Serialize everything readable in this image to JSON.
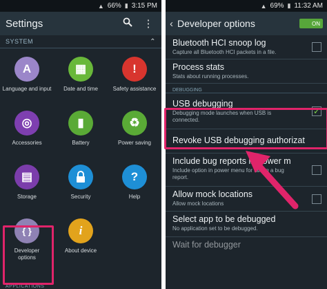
{
  "left": {
    "status": {
      "battery": "66%",
      "time": "3:15 PM"
    },
    "title": "Settings",
    "section": "SYSTEM",
    "items": [
      {
        "label": "Language and input",
        "glyph": "A",
        "color": "#9b86c9"
      },
      {
        "label": "Date and time",
        "glyph": "▦",
        "color": "#69b83a"
      },
      {
        "label": "Safety assistance",
        "glyph": "!",
        "color": "#d8352e"
      },
      {
        "label": "Accessories",
        "glyph": "◎",
        "color": "#7e3fb0"
      },
      {
        "label": "Battery",
        "glyph": "▮",
        "color": "#5aaa36"
      },
      {
        "label": "Power saving",
        "glyph": "♻",
        "color": "#5aaa36"
      },
      {
        "label": "Storage",
        "glyph": "▤",
        "color": "#7b3dab"
      },
      {
        "label": "Security",
        "glyph": "🔒",
        "color": "#1e8fd6"
      },
      {
        "label": "Help",
        "glyph": "?",
        "color": "#1e8fd6"
      },
      {
        "label": "Developer options",
        "glyph": "{ }",
        "color": "#8f82b4"
      },
      {
        "label": "About device",
        "glyph": "i",
        "color": "#e2a31c"
      }
    ],
    "footer": "APPLICATIONS"
  },
  "right": {
    "status": {
      "battery": "69%",
      "time": "11:32 AM"
    },
    "title": "Developer options",
    "toggle": "ON",
    "section": "DEBUGGING",
    "rows": [
      {
        "title": "Bluetooth HCI snoop log",
        "desc": "Capture all Bluetooth HCI packets in a file."
      },
      {
        "title": "Process stats",
        "desc": "Stats about running processes."
      },
      {
        "title": "USB debugging",
        "desc": "Debugging mode launches when USB is connected."
      },
      {
        "title": "Revoke USB debugging authorizat",
        "desc": ""
      },
      {
        "title": "Include bug reports in power m",
        "desc": "Include option in power menu for taking a bug report."
      },
      {
        "title": "Allow mock locations",
        "desc": "Allow mock locations"
      },
      {
        "title": "Select app to be debugged",
        "desc": "No application set to be debugged."
      },
      {
        "title": "Wait for debugger",
        "desc": ""
      }
    ]
  },
  "colors": {
    "highlight": "#e0246a",
    "accent_green": "#57a63a"
  }
}
